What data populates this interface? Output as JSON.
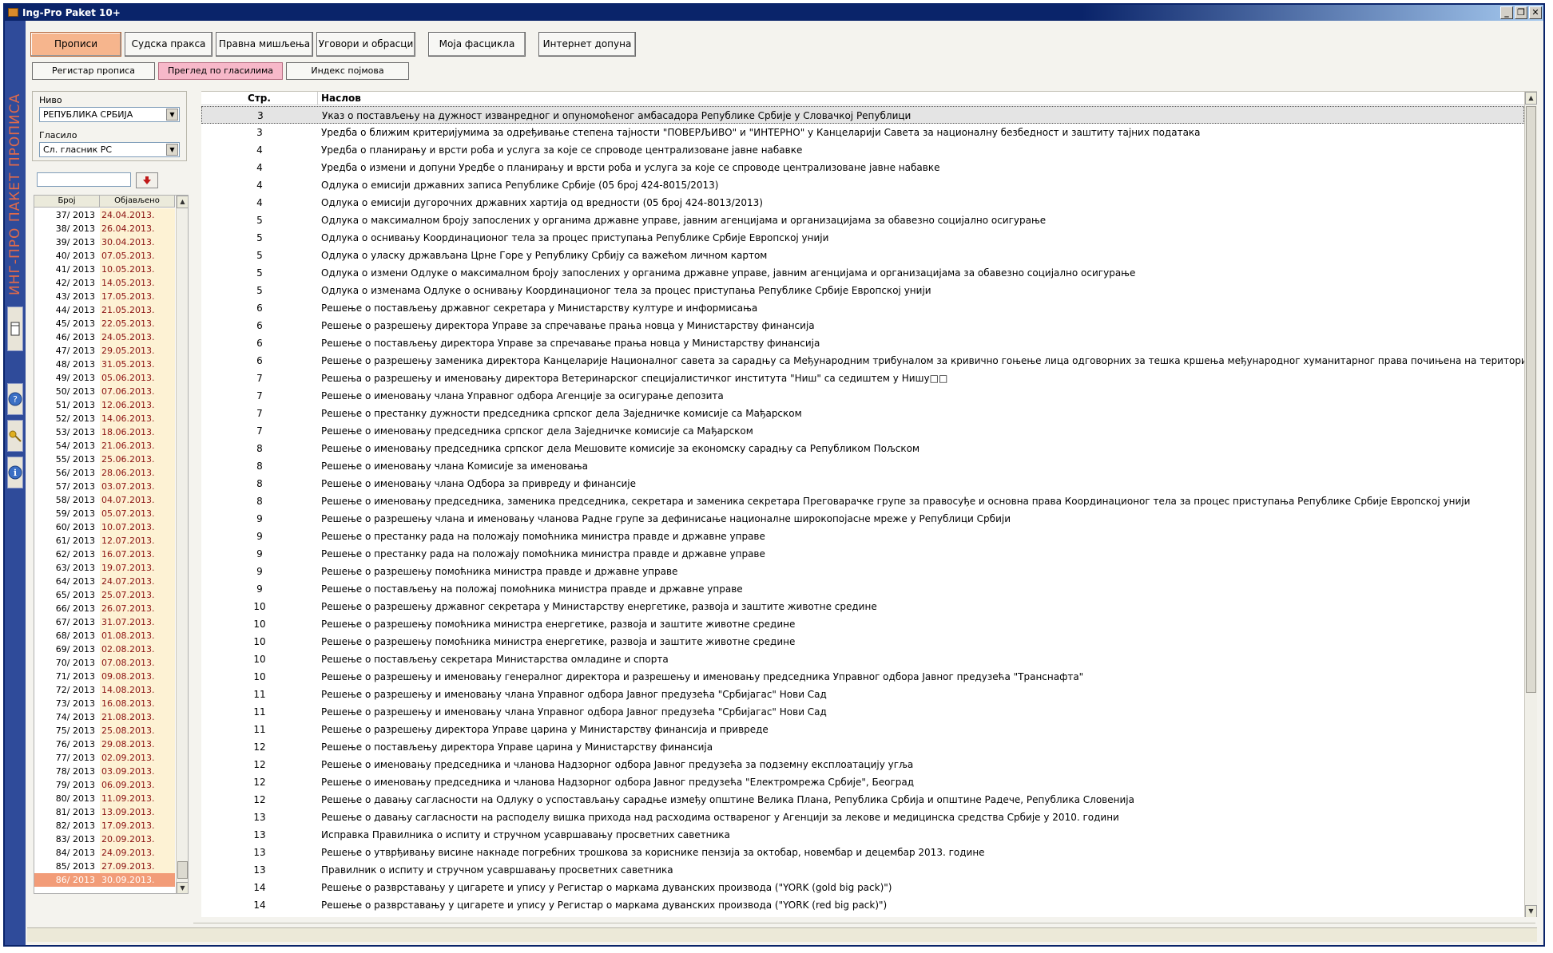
{
  "window": {
    "title": "Ing-Pro Paket 10+"
  },
  "brand": {
    "text": "ИНГ-ПРО ПАКЕТ ПРОПИСА"
  },
  "tabs": [
    {
      "label": "Прописи",
      "active": true
    },
    {
      "label": "Судска пракса"
    },
    {
      "label": "Правна мишљења"
    },
    {
      "label": "Уговори и обрасци"
    },
    {
      "label": "Моја фасцикла"
    },
    {
      "label": "Интернет допуна"
    }
  ],
  "subtabs": [
    {
      "label": "Регистар прописа"
    },
    {
      "label": "Преглед по гласилима",
      "active": true
    },
    {
      "label": "Индекс појмова"
    }
  ],
  "filters": {
    "level_label": "Ниво",
    "level_value": "РЕПУБЛИКА СРБИЈА",
    "gazette_label": "Гласило",
    "gazette_value": "Сл. гласник РС"
  },
  "issues": {
    "headers": [
      "Број",
      "Објављено"
    ],
    "rows": [
      [
        "37/ 2013",
        "24.04.2013."
      ],
      [
        "38/ 2013",
        "26.04.2013."
      ],
      [
        "39/ 2013",
        "30.04.2013."
      ],
      [
        "40/ 2013",
        "07.05.2013."
      ],
      [
        "41/ 2013",
        "10.05.2013."
      ],
      [
        "42/ 2013",
        "14.05.2013."
      ],
      [
        "43/ 2013",
        "17.05.2013."
      ],
      [
        "44/ 2013",
        "21.05.2013."
      ],
      [
        "45/ 2013",
        "22.05.2013."
      ],
      [
        "46/ 2013",
        "24.05.2013."
      ],
      [
        "47/ 2013",
        "29.05.2013."
      ],
      [
        "48/ 2013",
        "31.05.2013."
      ],
      [
        "49/ 2013",
        "05.06.2013."
      ],
      [
        "50/ 2013",
        "07.06.2013."
      ],
      [
        "51/ 2013",
        "12.06.2013."
      ],
      [
        "52/ 2013",
        "14.06.2013."
      ],
      [
        "53/ 2013",
        "18.06.2013."
      ],
      [
        "54/ 2013",
        "21.06.2013."
      ],
      [
        "55/ 2013",
        "25.06.2013."
      ],
      [
        "56/ 2013",
        "28.06.2013."
      ],
      [
        "57/ 2013",
        "03.07.2013."
      ],
      [
        "58/ 2013",
        "04.07.2013."
      ],
      [
        "59/ 2013",
        "05.07.2013."
      ],
      [
        "60/ 2013",
        "10.07.2013."
      ],
      [
        "61/ 2013",
        "12.07.2013."
      ],
      [
        "62/ 2013",
        "16.07.2013."
      ],
      [
        "63/ 2013",
        "19.07.2013."
      ],
      [
        "64/ 2013",
        "24.07.2013."
      ],
      [
        "65/ 2013",
        "25.07.2013."
      ],
      [
        "66/ 2013",
        "26.07.2013."
      ],
      [
        "67/ 2013",
        "31.07.2013."
      ],
      [
        "68/ 2013",
        "01.08.2013."
      ],
      [
        "69/ 2013",
        "02.08.2013."
      ],
      [
        "70/ 2013",
        "07.08.2013."
      ],
      [
        "71/ 2013",
        "09.08.2013."
      ],
      [
        "72/ 2013",
        "14.08.2013."
      ],
      [
        "73/ 2013",
        "16.08.2013."
      ],
      [
        "74/ 2013",
        "21.08.2013."
      ],
      [
        "75/ 2013",
        "25.08.2013."
      ],
      [
        "76/ 2013",
        "29.08.2013."
      ],
      [
        "77/ 2013",
        "02.09.2013."
      ],
      [
        "78/ 2013",
        "03.09.2013."
      ],
      [
        "79/ 2013",
        "06.09.2013."
      ],
      [
        "80/ 2013",
        "11.09.2013."
      ],
      [
        "81/ 2013",
        "13.09.2013."
      ],
      [
        "82/ 2013",
        "17.09.2013."
      ],
      [
        "83/ 2013",
        "20.09.2013."
      ],
      [
        "84/ 2013",
        "24.09.2013."
      ],
      [
        "85/ 2013",
        "27.09.2013."
      ],
      [
        "86/ 2013",
        "30.09.2013."
      ]
    ],
    "selected_index": 49
  },
  "list": {
    "headers": [
      "Стр.",
      "Наслов"
    ],
    "selected_index": 0,
    "rows": [
      [
        "3",
        "Указ о постављењу на дужност изванредног и опуномоћеног амбасадора Републике Србије у Словачкој Републици"
      ],
      [
        "3",
        "Уредба о ближим критеријумима за одређивање степена тајности \"ПОВЕРЉИВО\" и \"ИНТЕРНО\" у Канцеларији Савета за националну безбедност и заштиту тајних података"
      ],
      [
        "4",
        "Уредба о планирању и врсти роба и услуга за које се спроводе централизоване јавне набавке"
      ],
      [
        "4",
        "Уредба о измени и допуни Уредбе о планирању и врсти роба и услуга за које се спроводе централизоване јавне набавке"
      ],
      [
        "4",
        "Одлука о емисији државних записа Републике Србије (05 број 424-8015/2013)"
      ],
      [
        "4",
        "Одлука о емисији дугорочних државних хартија од вредности (05 број 424-8013/2013)"
      ],
      [
        "5",
        "Одлука о максималном броју запослених у органима државне управе, јавним агенцијама и организацијама за обавезно социјално осигурање"
      ],
      [
        "5",
        "Одлука о оснивању Координационог тела за процес приступања Републике Србије Европској унији"
      ],
      [
        "5",
        "Одлука о уласку држављана Црне Горе у Републику Србију са важећом личном картом"
      ],
      [
        "5",
        "Одлука о измени Одлуке о максималном броју запослених у органима државне управе, јавним агенцијама и организацијама за обавезно социјално осигурање"
      ],
      [
        "5",
        "Одлука о изменама Одлуке о оснивању Координационог тела за процес приступања Републике Србије Европској унији"
      ],
      [
        "6",
        "Решење о постављењу државног секретара у Министарству културе и информисања"
      ],
      [
        "6",
        "Решење о разрешењу директора Управе за спречавање прања новца у Министарству финансија"
      ],
      [
        "6",
        "Решење о постављењу директора Управе за спречавање прања новца у Министарству финансија"
      ],
      [
        "6",
        "Решење о разрешењу заменика директора Канцеларије Националног савета за сарадњу са Међународним трибуналом за кривично гоњење лица одговорних за тешка кршења међународног хуманитарног права почињена на територији бивше Југославије"
      ],
      [
        "7",
        "Решења о разрешењу и именовању директора Ветеринарског специјалистичког института \"Ниш\" са седиштем у Нишу□□"
      ],
      [
        "7",
        "Решење о именовању члана Управног одбора Агенције за осигурање депозита"
      ],
      [
        "7",
        "Решење о престанку дужности председника српског дела Заједничке комисије са Мађарском"
      ],
      [
        "7",
        "Решење о именовању председника српског дела Заједничке комисије са Мађарском"
      ],
      [
        "8",
        "Решење о именовању председника српског дела Мешовите комисије за економску сарадњу са Републиком Пољском"
      ],
      [
        "8",
        "Решење о именовању члана Комисије за именовања"
      ],
      [
        "8",
        "Решење о именовању члана Одбора за привреду и финансије"
      ],
      [
        "8",
        "Решење о именовању председника, заменика председника, секретара и заменика секретара Преговарачке групе за правосуђе и основна права Координационог тела за процес приступања Републике Србије Европској унији"
      ],
      [
        "9",
        "Решење о разрешењу члана и именовању чланова Радне групе за дефинисање националне широкопојасне мреже у Републици Србији"
      ],
      [
        "9",
        "Решење о престанку рада на положају помоћника министра правде и државне управе"
      ],
      [
        "9",
        "Решење о престанку рада на положају помоћника министра правде и државне управе"
      ],
      [
        "9",
        "Решење о разрешењу помоћника министра правде и државне управе"
      ],
      [
        "9",
        "Решење о постављењу на положај помоћника министра правде и државне управе"
      ],
      [
        "10",
        "Решење о разрешењу државног секретара у Министарству енергетике, развоја и заштите животне средине"
      ],
      [
        "10",
        "Решење о разрешењу помоћника министра енергетике, развоја и заштите животне средине"
      ],
      [
        "10",
        "Решење о разрешењу помоћника министра енергетике, развоја и заштите животне средине"
      ],
      [
        "10",
        "Решење о постављењу секретара Министарства омладине и спорта"
      ],
      [
        "10",
        "Решење о разрешењу и именовању генералног директора и разрешењу и именовању председника Управног одбора Јавног предузећа \"Транснафта\""
      ],
      [
        "11",
        "Решење о разрешењу и именовању члана Управног одбора Јавног предузећа \"Србијагас\" Нови Сад"
      ],
      [
        "11",
        "Решење о разрешењу и именовању члана Управног одбора Јавног предузећа \"Србијагас\" Нови Сад"
      ],
      [
        "11",
        "Решење о разрешењу директора Управе царина у Министарству финансија и привреде"
      ],
      [
        "12",
        "Решење о постављењу директора Управе царина у Министарству финансија"
      ],
      [
        "12",
        "Решење о именовању председника и чланова Надзорног одбора Јавног предузећа за подземну експлоатацију угља"
      ],
      [
        "12",
        "Решење о именовању председника и чланова Надзорног одбора Јавног предузећа \"Електромрежа Србије\", Београд"
      ],
      [
        "12",
        "Решење о давању сагласности на Одлуку о успостављању сарадње између општине Велика Плана, Република Србија и општине Радече, Република Словенија"
      ],
      [
        "13",
        "Решење о давању сагласности на расподелу вишка прихода над расходима оствареног у Агенцији за лекове и медицинска средства Србије у 2010. години"
      ],
      [
        "13",
        "Исправка Правилника о испиту и стручном усавршавању просветних саветника"
      ],
      [
        "13",
        "Решење о утврђивању висине накнаде погребних трошкова за кориснике пензија за октобар, новембар и децембар 2013. године"
      ],
      [
        "13",
        "Правилник о испиту и стручном усавршавању просветних саветника"
      ],
      [
        "14",
        "Решење о разврставању у цигарете и упису у Регистар о маркама дуванских производа (\"YORK (gold big pack)\")"
      ],
      [
        "14",
        "Решење о разврставању у цигарете и упису у Регистар о маркама дуванских производа (\"YORK (red big pack)\")"
      ]
    ]
  }
}
